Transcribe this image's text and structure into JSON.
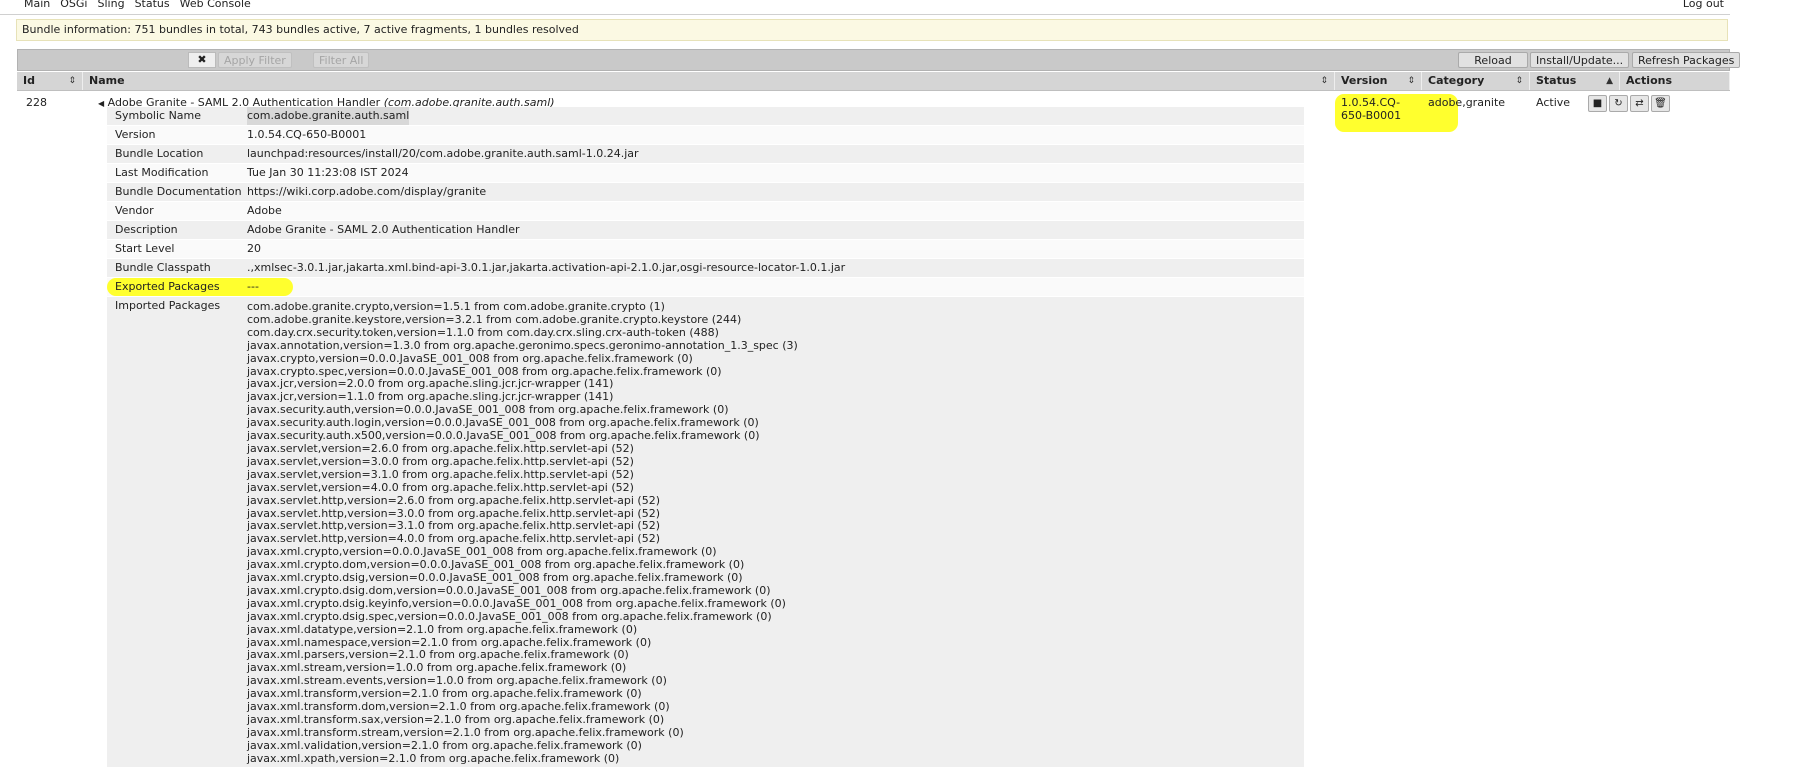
{
  "nav": {
    "items": [
      "Main",
      "OSGi",
      "Sling",
      "Status",
      "Web Console"
    ],
    "logout": "Log out"
  },
  "status": "Bundle information: 751 bundles in total, 743 bundles active, 7 active fragments, 1 bundles resolved",
  "toolbar": {
    "clear": "✖",
    "apply_filter": "Apply Filter",
    "filter_all": "Filter All",
    "reload": "Reload",
    "install_update": "Install/Update...",
    "refresh_packages": "Refresh Packages"
  },
  "columns": {
    "id": "Id",
    "name": "Name",
    "version": "Version",
    "category": "Category",
    "status": "Status",
    "actions": "Actions"
  },
  "bundle": {
    "id": "228",
    "name": "Adobe Granite - SAML 2.0 Authentication Handler ",
    "symbolic": "(com.adobe.granite.auth.saml)",
    "version_line1": "1.0.54.CQ-",
    "version_line2": "650-B0001",
    "category": "adobe,granite",
    "status": "Active"
  },
  "details": [
    {
      "label": "Symbolic Name",
      "value": "com.adobe.granite.auth.saml"
    },
    {
      "label": "Version",
      "value": "1.0.54.CQ-650-B0001"
    },
    {
      "label": "Bundle Location",
      "value": "launchpad:resources/install/20/com.adobe.granite.auth.saml-1.0.24.jar"
    },
    {
      "label": "Last Modification",
      "value": "Tue Jan 30 11:23:08 IST 2024"
    },
    {
      "label": "Bundle Documentation",
      "value": "https://wiki.corp.adobe.com/display/granite"
    },
    {
      "label": "Vendor",
      "value": "Adobe"
    },
    {
      "label": "Description",
      "value": "Adobe Granite - SAML 2.0 Authentication Handler"
    },
    {
      "label": "Start Level",
      "value": "20"
    },
    {
      "label": "Bundle Classpath",
      "value": ".,xmlsec-3.0.1.jar,jakarta.xml.bind-api-3.0.1.jar,jakarta.activation-api-2.1.0.jar,osgi-resource-locator-1.0.1.jar"
    },
    {
      "label": "Exported Packages",
      "value": "---"
    }
  ],
  "imported_label": "Imported Packages",
  "imported": [
    "com.adobe.granite.crypto,version=1.5.1 from com.adobe.granite.crypto (1)",
    "com.adobe.granite.keystore,version=3.2.1 from com.adobe.granite.crypto.keystore (244)",
    "com.day.crx.security.token,version=1.1.0 from com.day.crx.sling.crx-auth-token (488)",
    "javax.annotation,version=1.3.0 from org.apache.geronimo.specs.geronimo-annotation_1.3_spec (3)",
    "javax.crypto,version=0.0.0.JavaSE_001_008 from org.apache.felix.framework (0)",
    "javax.crypto.spec,version=0.0.0.JavaSE_001_008 from org.apache.felix.framework (0)",
    "javax.jcr,version=2.0.0 from org.apache.sling.jcr.jcr-wrapper (141)",
    "javax.jcr,version=1.1.0 from org.apache.sling.jcr.jcr-wrapper (141)",
    "javax.security.auth,version=0.0.0.JavaSE_001_008 from org.apache.felix.framework (0)",
    "javax.security.auth.login,version=0.0.0.JavaSE_001_008 from org.apache.felix.framework (0)",
    "javax.security.auth.x500,version=0.0.0.JavaSE_001_008 from org.apache.felix.framework (0)",
    "javax.servlet,version=2.6.0 from org.apache.felix.http.servlet-api (52)",
    "javax.servlet,version=3.0.0 from org.apache.felix.http.servlet-api (52)",
    "javax.servlet,version=3.1.0 from org.apache.felix.http.servlet-api (52)",
    "javax.servlet,version=4.0.0 from org.apache.felix.http.servlet-api (52)",
    "javax.servlet.http,version=2.6.0 from org.apache.felix.http.servlet-api (52)",
    "javax.servlet.http,version=3.0.0 from org.apache.felix.http.servlet-api (52)",
    "javax.servlet.http,version=3.1.0 from org.apache.felix.http.servlet-api (52)",
    "javax.servlet.http,version=4.0.0 from org.apache.felix.http.servlet-api (52)",
    "javax.xml.crypto,version=0.0.0.JavaSE_001_008 from org.apache.felix.framework (0)",
    "javax.xml.crypto.dom,version=0.0.0.JavaSE_001_008 from org.apache.felix.framework (0)",
    "javax.xml.crypto.dsig,version=0.0.0.JavaSE_001_008 from org.apache.felix.framework (0)",
    "javax.xml.crypto.dsig.dom,version=0.0.0.JavaSE_001_008 from org.apache.felix.framework (0)",
    "javax.xml.crypto.dsig.keyinfo,version=0.0.0.JavaSE_001_008 from org.apache.felix.framework (0)",
    "javax.xml.crypto.dsig.spec,version=0.0.0.JavaSE_001_008 from org.apache.felix.framework (0)",
    "javax.xml.datatype,version=2.1.0 from org.apache.felix.framework (0)",
    "javax.xml.namespace,version=2.1.0 from org.apache.felix.framework (0)",
    "javax.xml.parsers,version=2.1.0 from org.apache.felix.framework (0)",
    "javax.xml.stream,version=1.0.0 from org.apache.felix.framework (0)",
    "javax.xml.stream.events,version=1.0.0 from org.apache.felix.framework (0)",
    "javax.xml.transform,version=2.1.0 from org.apache.felix.framework (0)",
    "javax.xml.transform.dom,version=2.1.0 from org.apache.felix.framework (0)",
    "javax.xml.transform.sax,version=2.1.0 from org.apache.felix.framework (0)",
    "javax.xml.transform.stream,version=2.1.0 from org.apache.felix.framework (0)",
    "javax.xml.validation,version=2.1.0 from org.apache.felix.framework (0)",
    "javax.xml.xpath,version=2.1.0 from org.apache.felix.framework (0)"
  ],
  "highlight_color": "#ffff2e"
}
